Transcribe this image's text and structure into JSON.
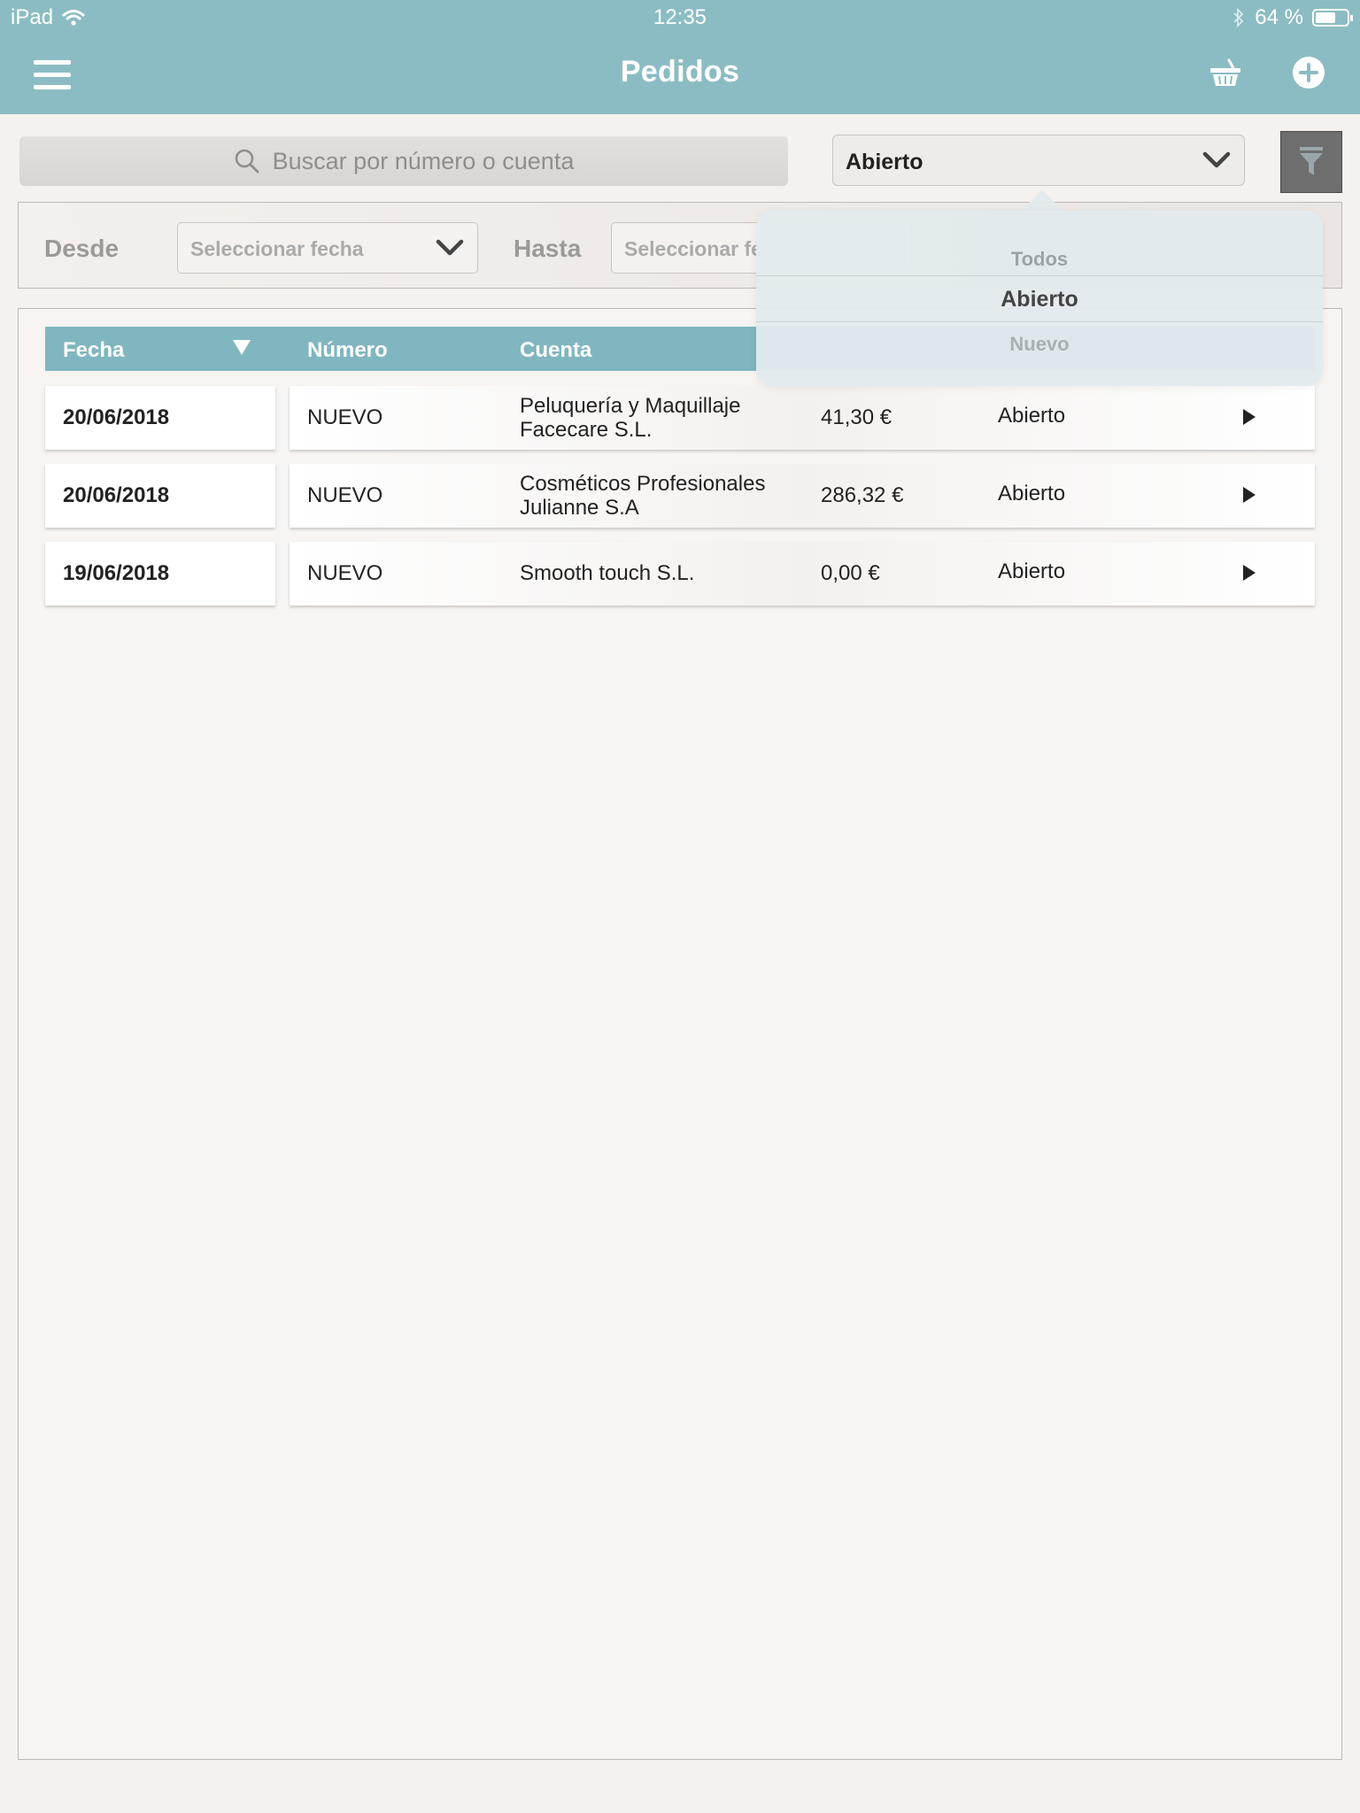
{
  "status_bar": {
    "device": "iPad",
    "time": "12:35",
    "battery": "64 %",
    "battery_level_percent": 64
  },
  "header": {
    "title": "Pedidos",
    "icons": [
      "menu-icon",
      "basket-icon",
      "add-icon"
    ]
  },
  "search": {
    "placeholder": "Buscar por número o cuenta",
    "value": ""
  },
  "status_filter": {
    "selected": "Abierto",
    "options": [
      "Todos",
      "Abierto",
      "Nuevo"
    ]
  },
  "date_filter": {
    "from_label": "Desde",
    "from_placeholder": "Seleccionar fecha",
    "to_label": "Hasta",
    "to_placeholder": "Seleccionar fe"
  },
  "table": {
    "columns": {
      "fecha": "Fecha",
      "numero": "Número",
      "cuenta": "Cuenta"
    },
    "rows": [
      {
        "fecha": "20/06/2018",
        "numero": "NUEVO",
        "cuenta_line1": "Peluquería y Maquillaje",
        "cuenta_line2": "Facecare S.L.",
        "importe": "41,30 €",
        "estado": "Abierto"
      },
      {
        "fecha": "20/06/2018",
        "numero": "NUEVO",
        "cuenta_line1": "Cosméticos Profesionales",
        "cuenta_line2": "Julianne S.A",
        "importe": "286,32 €",
        "estado": "Abierto"
      },
      {
        "fecha": "19/06/2018",
        "numero": "NUEVO",
        "cuenta_line1": "Smooth touch S.L.",
        "cuenta_line2": "",
        "importe": "0,00 €",
        "estado": "Abierto"
      }
    ]
  },
  "colors": {
    "header_bg": "#8cbcc3",
    "table_header_bg": "#80b6bf",
    "background": "#f5f1ee"
  }
}
